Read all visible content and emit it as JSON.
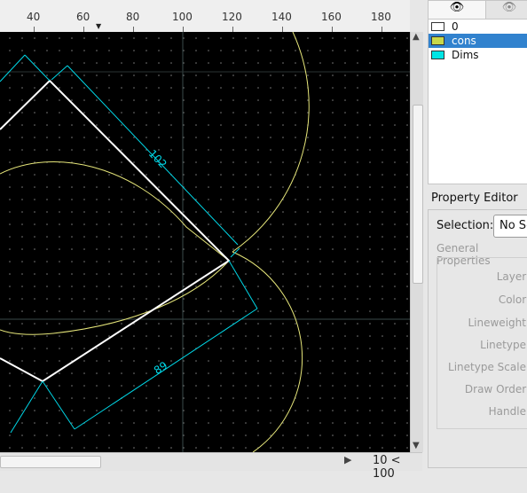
{
  "ruler": {
    "ticks": [
      "40",
      "60",
      "80",
      "100",
      "120",
      "140",
      "160",
      "180"
    ]
  },
  "drawing": {
    "dimensions": [
      "102",
      "89"
    ]
  },
  "hscroll": {
    "zoom_label": "10 < 100"
  },
  "layers": {
    "items": [
      {
        "name": "0",
        "color": "#ffffff"
      },
      {
        "name": "cons",
        "color": "#c8d84a"
      },
      {
        "name": "Dims",
        "color": "#00e5e5"
      }
    ],
    "selected": "cons"
  },
  "property_editor": {
    "title": "Property Editor",
    "selection_label": "Selection:",
    "selection_value": "No Se",
    "general_title": "General Properties",
    "labels": [
      "Layer:",
      "Color:",
      "Lineweight:",
      "Linetype:",
      "Linetype Scale:",
      "Draw Order:",
      "Handle:"
    ]
  },
  "colors": {
    "canvas": "#000000",
    "dim": "#00d8e8",
    "cons": "#e6e67a",
    "entity": "#ffffff",
    "selection": "#3182ce"
  }
}
